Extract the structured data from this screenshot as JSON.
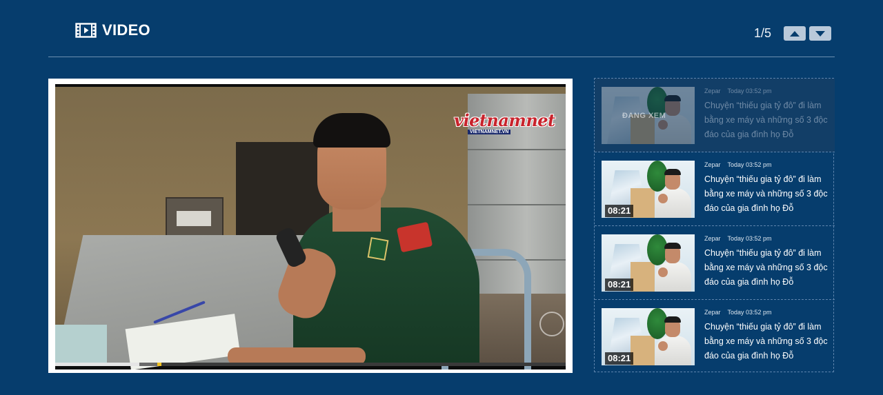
{
  "header": {
    "title": "VIDEO",
    "pager": "1/5",
    "icon": "film-icon"
  },
  "player": {
    "logo_text": "vietnamnet",
    "logo_sub": "VIETNAMNET.VN",
    "progress": {
      "played_fraction": 0.165,
      "buffer_end_fraction": 0.205,
      "marker_fraction": 0.2
    },
    "colors": {
      "progress_played": "#e5e5e5",
      "progress_marker": "#f2c322"
    }
  },
  "playlist": {
    "items": [
      {
        "author": "Zepar",
        "time": "Today 03:52 pm",
        "title": "Chuyện “thiếu gia tỷ đô” đi làm bằng xe máy và những số 3 độc đáo của gia đình họ Đỗ",
        "duration": "",
        "overlay_label": "ĐANG XEM",
        "active": true
      },
      {
        "author": "Zepar",
        "time": "Today 03:52 pm",
        "title": "Chuyện “thiếu gia tỷ đô” đi làm bằng xe máy và những số 3 độc đáo của gia đình họ Đỗ",
        "duration": "08:21",
        "active": false
      },
      {
        "author": "Zepar",
        "time": "Today 03:52 pm",
        "title": "Chuyện “thiếu gia tỷ đô” đi làm bằng xe máy và những số 3 độc đáo của gia đình họ Đỗ",
        "duration": "08:21",
        "active": false
      },
      {
        "author": "Zepar",
        "time": "Today 03:52 pm",
        "title": "Chuyện “thiếu gia tỷ đô” đi làm bằng xe máy và những số 3 độc đáo của gia đình họ Đỗ",
        "duration": "08:21",
        "active": false
      }
    ]
  },
  "colors": {
    "background": "#063d6d",
    "active_item": "#123e67",
    "divider": "#6d8fb0",
    "pager_button": "#b9c9da"
  }
}
